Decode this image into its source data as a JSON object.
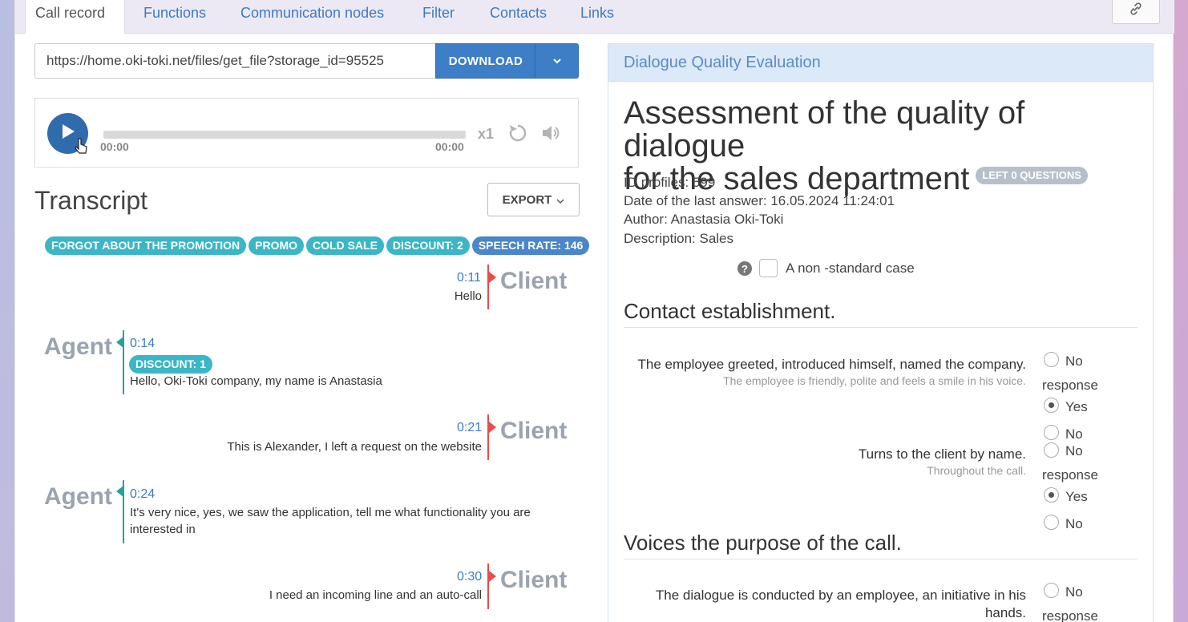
{
  "tabs": [
    "Call record",
    "Functions",
    "Communication nodes",
    "Filter",
    "Contacts",
    "Links"
  ],
  "active_tab": "Call record",
  "url_value": "https://home.oki-toki.net/files/get_file?storage_id=95525",
  "download_label": "DOWNLOAD",
  "player": {
    "time_start": "00:00",
    "time_end": "00:00",
    "speed": "x1"
  },
  "transcript": {
    "title": "Transcript",
    "export_label": "EXPORT",
    "tags": [
      "FORGOT ABOUT THE PROMOTION",
      "PROMO",
      "COLD SALE",
      "DISCOUNT: 2",
      "SPEECH RATE: 146"
    ],
    "messages": [
      {
        "speaker": "Client",
        "time": "0:11",
        "text": "Hello"
      },
      {
        "speaker": "Agent",
        "time": "0:14",
        "tag": "DISCOUNT: 1",
        "text": "Hello, Oki-Toki company, my name is Anastasia"
      },
      {
        "speaker": "Client",
        "time": "0:21",
        "text": "This is Alexander, I left a request on the website"
      },
      {
        "speaker": "Agent",
        "time": "0:24",
        "text_line1": "It's very nice, yes, we saw the application, tell me what functionality you are",
        "text_line2": "interested in"
      },
      {
        "speaker": "Client",
        "time": "0:30",
        "text": "I need an incoming line and an auto-call"
      }
    ]
  },
  "evaluation": {
    "panel_title": "Dialogue Quality Evaluation",
    "title_line1": "Assessment of the quality of dialogue",
    "title_line2": "for the sales department",
    "left_badge": "LEFT 0 QUESTIONS",
    "id_profiles": "ID profiles: 599",
    "last_answer": "Date of the last answer: 16.05.2024 11:24:01",
    "author": "Author: Anastasia Oki-Toki",
    "description": "Description: Sales",
    "non_standard_label": "A non -standard case",
    "sections": [
      {
        "title": "Contact establishment.",
        "questions": [
          {
            "text": "The employee greeted, introduced himself, named the company.",
            "sub": "The employee is friendly, polite and feels a smile in his voice.",
            "selected": "Yes"
          },
          {
            "text": "Turns to the client by name.",
            "sub": "Throughout the call.",
            "selected": "Yes"
          }
        ]
      },
      {
        "title": "Voices the purpose of the call.",
        "questions": [
          {
            "text_line1": "The dialogue is conducted by an employee, an initiative in his",
            "text_line2": "hands."
          }
        ]
      }
    ],
    "options": {
      "no_response_1": "No",
      "no_response_2": "response",
      "yes": "Yes",
      "no": "No"
    }
  },
  "icons": {
    "link": "link-icon",
    "caret": "chevron-down-icon",
    "play": "play-icon",
    "repeat": "repeat-icon",
    "volume": "volume-icon",
    "help": "help-icon"
  },
  "colors": {
    "accent": "#3d7ec6",
    "tag": "#3ab6c7",
    "client_line": "#e84c4c",
    "agent_line": "#22a39a"
  }
}
